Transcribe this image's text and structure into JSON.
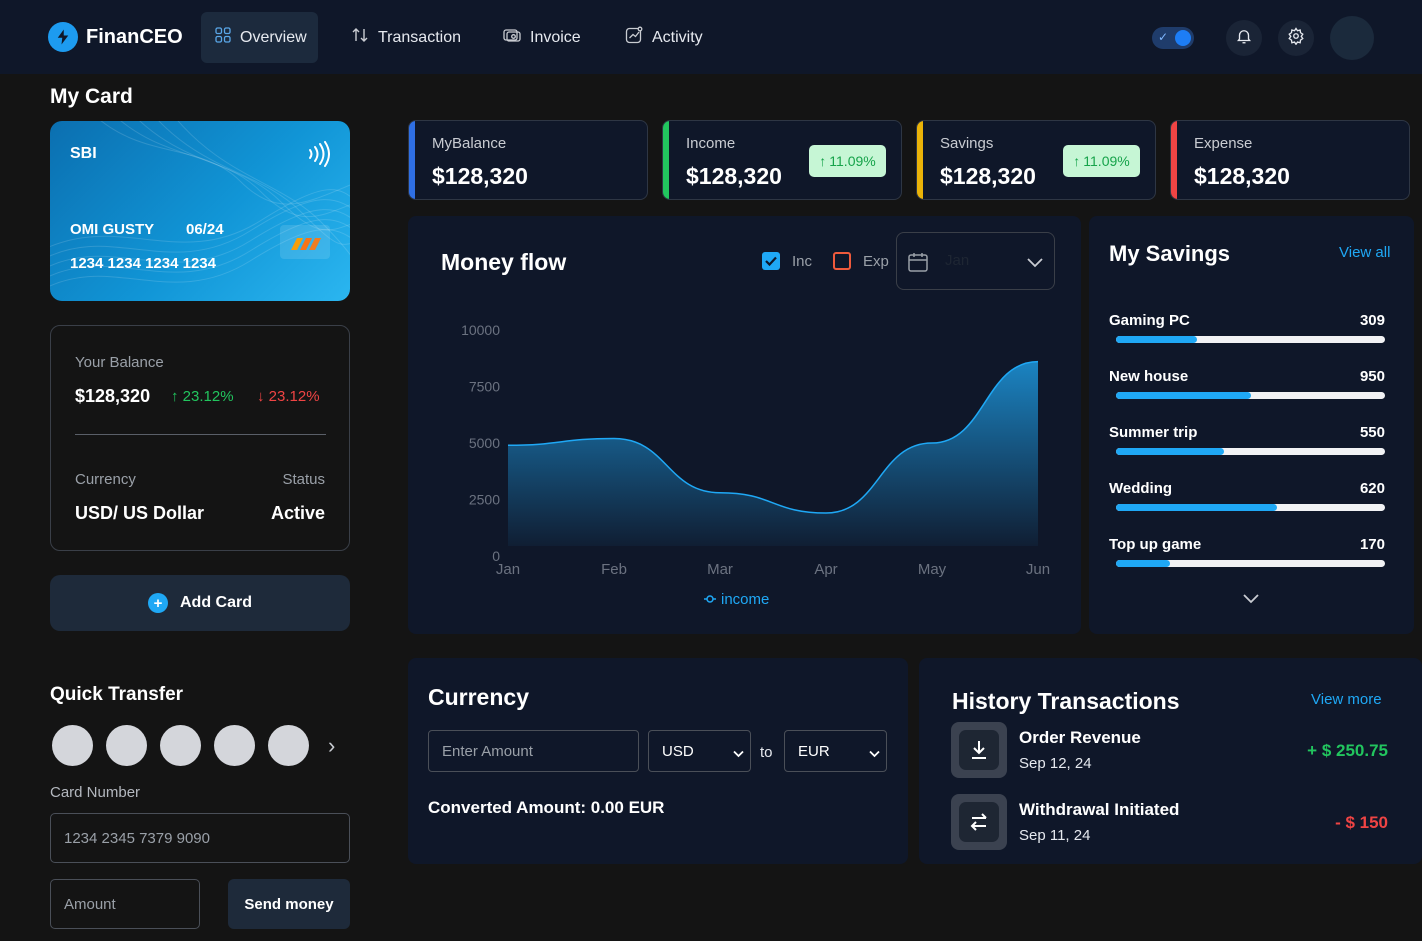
{
  "app": {
    "name": "FinanCEO"
  },
  "nav": {
    "items": [
      {
        "label": "Overview",
        "icon": "grid-icon",
        "active": true
      },
      {
        "label": "Transaction",
        "icon": "arrows-updown-icon",
        "active": false
      },
      {
        "label": "Invoice",
        "icon": "receipt-icon",
        "active": false
      },
      {
        "label": "Activity",
        "icon": "trend-icon",
        "active": false
      }
    ],
    "theme_toggle_on": true
  },
  "my_card": {
    "heading": "My Card",
    "bank": "SBI",
    "holder": "OMI GUSTY",
    "expiry": "06/24",
    "number": "1234 1234 1234 1234"
  },
  "balance": {
    "label": "Your Balance",
    "value": "$128,320",
    "change_up": "23.12%",
    "change_down": "23.12%",
    "currency_label": "Currency",
    "currency_value": "USD/ US Dollar",
    "status_label": "Status",
    "status_value": "Active"
  },
  "add_card": {
    "label": "Add Card"
  },
  "quick_transfer": {
    "heading": "Quick Transfer",
    "contacts_count": 5,
    "card_number_label": "Card Number",
    "card_number_placeholder": "1234 2345 7379 9090",
    "amount_placeholder": "Amount",
    "send_label": "Send money"
  },
  "stats": [
    {
      "label": "MyBalance",
      "value": "$128,320",
      "badge": "",
      "color": "#2f6fe4"
    },
    {
      "label": "Income",
      "value": "$128,320",
      "badge": "11.09%",
      "color": "#22c55e"
    },
    {
      "label": "Savings",
      "value": "$128,320",
      "badge": "11.09%",
      "color": "#eab308"
    },
    {
      "label": "Expense",
      "value": "$128,320",
      "badge": "",
      "color": "#ef4444"
    }
  ],
  "money_flow": {
    "title": "Money flow",
    "inc_label": "Inc",
    "exp_label": "Exp",
    "inc_checked": true,
    "exp_checked": false,
    "month_select": "Jan"
  },
  "chart_data": {
    "type": "area",
    "categories": [
      "Jan",
      "Feb",
      "Mar",
      "Apr",
      "May",
      "Jun"
    ],
    "series": [
      {
        "name": "income",
        "values": [
          4900,
          5200,
          2800,
          1900,
          5000,
          8600
        ]
      }
    ],
    "ylim": [
      0,
      10000
    ],
    "yticks": [
      0,
      2500,
      5000,
      7500,
      10000
    ],
    "legend": "bottom",
    "grid": false,
    "color": "#1fa8f5"
  },
  "savings": {
    "title": "My Savings",
    "view_all": "View all",
    "items": [
      {
        "name": "Gaming PC",
        "value": "309",
        "progress": 0.3
      },
      {
        "name": "New house",
        "value": "950",
        "progress": 0.5
      },
      {
        "name": "Summer trip",
        "value": "550",
        "progress": 0.4
      },
      {
        "name": "Wedding",
        "value": "620",
        "progress": 0.6
      },
      {
        "name": "Top up game",
        "value": "170",
        "progress": 0.2
      }
    ]
  },
  "currency": {
    "title": "Currency",
    "amount_placeholder": "Enter Amount",
    "from": "USD",
    "to_label": "to",
    "to": "EUR",
    "converted": "Converted Amount: 0.00 EUR"
  },
  "history": {
    "title": "History Transactions",
    "view_more": "View more",
    "items": [
      {
        "name": "Order Revenue",
        "date": "Sep 12, 24",
        "amount": "+ $ 250.75",
        "positive": true
      },
      {
        "name": "Withdrawal Initiated",
        "date": "Sep 11, 24",
        "amount": "- $ 150",
        "positive": false
      }
    ]
  }
}
